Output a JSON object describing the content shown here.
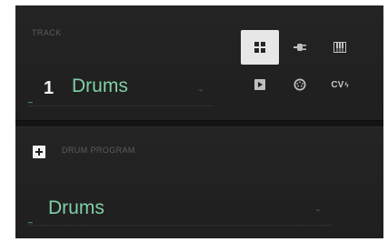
{
  "track": {
    "section_label": "TRACK",
    "number": "1",
    "name": "Drums",
    "selected_type": "drum",
    "types": [
      {
        "id": "drum",
        "icon": "grid-icon"
      },
      {
        "id": "plugin",
        "icon": "plug-icon"
      },
      {
        "id": "keygroup",
        "icon": "keyboard-icon"
      },
      {
        "id": "clip",
        "icon": "play-icon"
      },
      {
        "id": "midi",
        "icon": "midi-port-icon"
      },
      {
        "id": "cv",
        "label": "CV",
        "icon": "lightning-icon"
      }
    ]
  },
  "drum_program": {
    "section_label": "DRUM PROGRAM",
    "name": "Drums"
  },
  "colors": {
    "accent": "#7fd0a6",
    "panel": "#1f1f1f",
    "active_button": "#e7e7e7"
  }
}
